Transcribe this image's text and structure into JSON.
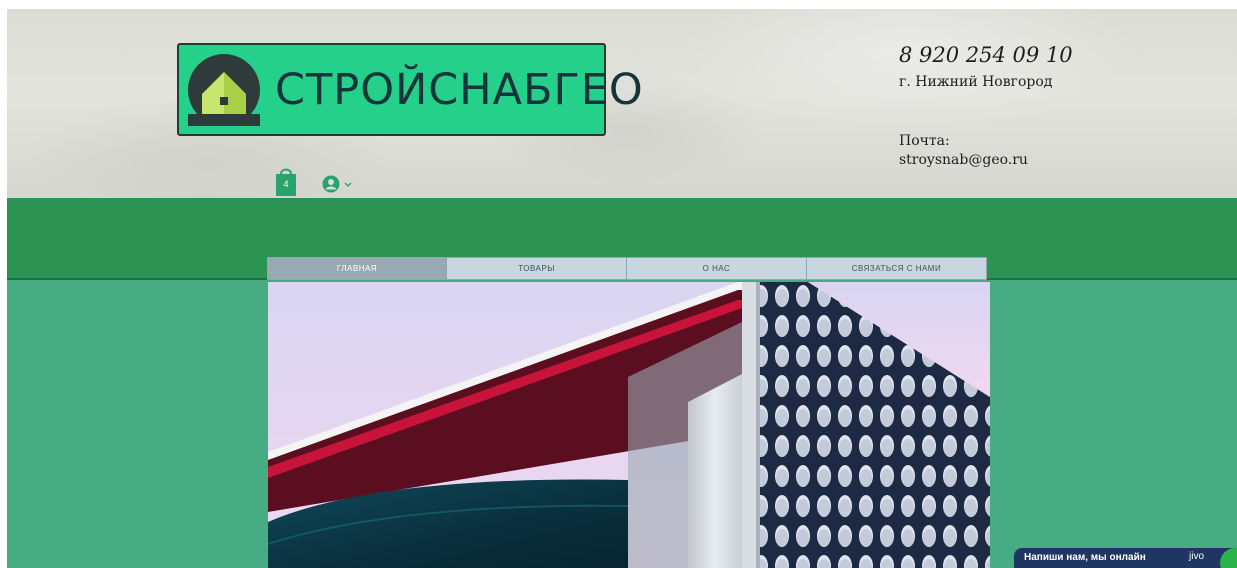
{
  "header": {
    "logo_text": "СТРОЙСНАБГЕО",
    "cart_count": "4",
    "phone": "8 920 254 09 10",
    "city": "г. Нижний Новгород",
    "mail_label": "Почта:",
    "mail": "stroysnab@geo.ru"
  },
  "nav": {
    "items": [
      {
        "label": "ГЛАВНАЯ"
      },
      {
        "label": "ТОВАРЫ"
      },
      {
        "label": "О НАС"
      },
      {
        "label": "СВЯЗАТЬСЯ С НАМИ"
      }
    ],
    "active": "ГЛАВНАЯ"
  },
  "chat": {
    "text": "Напиши нам, мы онлайн",
    "brand": "jivo"
  },
  "colors": {
    "logo_bg": "#25d08a",
    "band_green": "#2c9352",
    "main_green": "#47ac84",
    "nav_bg": "#c8d6e0",
    "nav_active": "#98a9b3",
    "chat_bg": "#1f3562"
  },
  "icons": {
    "logo_mark": "house-logo-icon",
    "cart": "shopping-bag-icon",
    "user": "user-avatar-icon",
    "chevron": "chevron-down-icon"
  }
}
